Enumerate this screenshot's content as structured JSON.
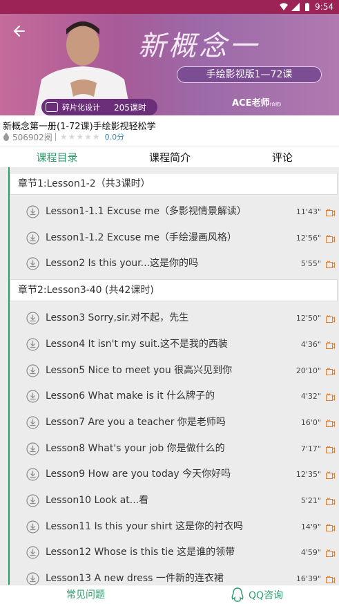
{
  "status_bar": {
    "time": "9:54"
  },
  "banner": {
    "headline": "新概念一",
    "subtitle": "手绘影视版1—72课",
    "tag_label": "碎片化设计",
    "lesson_count": "205课时",
    "teacher": "ACE老师",
    "teacher_note": "(合肥)"
  },
  "course": {
    "title": "新概念第一册(1-72课)手绘影视轻松学",
    "views": "506902阅",
    "stars": "★★★★★",
    "score": "0.0分"
  },
  "tabs": [
    {
      "label": "课程目录",
      "active": true
    },
    {
      "label": "课程简介",
      "active": false
    },
    {
      "label": "评论",
      "active": false
    }
  ],
  "chapters": [
    {
      "title": "章节1:Lesson1-2（共3课时）",
      "lessons": [
        {
          "name": "Lesson1-1.1 Excuse me（多影视情景解读）",
          "duration": "11'43\""
        },
        {
          "name": "Lesson1-1.2 Excuse me（手绘漫画风格）",
          "duration": "12'56\""
        },
        {
          "name": "Lesson2 Is this your...这是你的吗",
          "duration": "5'55\""
        }
      ]
    },
    {
      "title": "章节2:Lesson3-40 (共42课时)",
      "lessons": [
        {
          "name": "Lesson3 Sorry,sir.对不起，先生",
          "duration": "12'50\""
        },
        {
          "name": "Lesson4 It isn't my suit.这不是我的西装",
          "duration": "4'36\""
        },
        {
          "name": "Lesson5 Nice to meet you 很高兴见到你",
          "duration": "20'10\""
        },
        {
          "name": "Lesson6 What make is it 什么牌子的",
          "duration": "4'32\""
        },
        {
          "name": "Lesson7 Are you a teacher 你是老师吗",
          "duration": "16'0\""
        },
        {
          "name": "Lesson8 What's your job 你是做什么的",
          "duration": "7'17\""
        },
        {
          "name": "Lesson9 How are you today 今天你好吗",
          "duration": "12'35\""
        },
        {
          "name": "Lesson10 Look at...看",
          "duration": "5'21\""
        },
        {
          "name": "Lesson11 Is this your shirt 这是你的衬衣吗",
          "duration": "14'9\""
        },
        {
          "name": "Lesson12 Whose is this tie 这是谁的领带",
          "duration": "4'59\""
        },
        {
          "name": "Lesson13 A new dress 一件新的连衣裙",
          "duration": "16'39\""
        }
      ]
    }
  ],
  "bottom_bar": {
    "faq": "常见问题",
    "qq": "QQ咨询"
  },
  "colors": {
    "accent": "#2b9d6a",
    "status_bar": "#9b2356",
    "list_bg": "#ececec",
    "video_icon": "#e07a2c"
  }
}
